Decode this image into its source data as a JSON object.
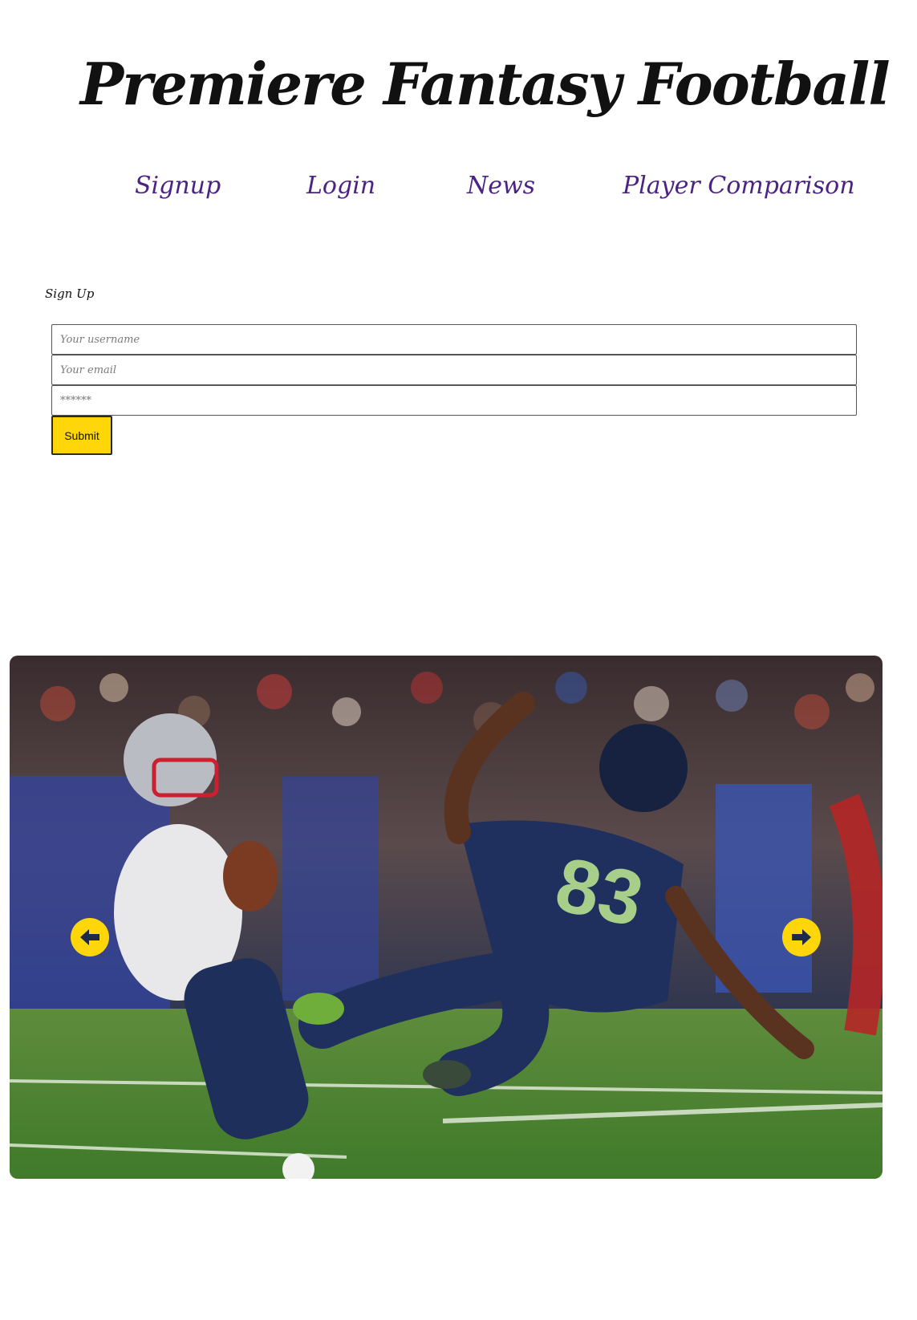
{
  "header": {
    "title": "Premiere Fantasy Football"
  },
  "nav": {
    "items": [
      {
        "label": "Signup"
      },
      {
        "label": "Login"
      },
      {
        "label": "News"
      },
      {
        "label": "Player Comparison"
      }
    ]
  },
  "signup": {
    "heading": "Sign Up",
    "username_placeholder": "Your username",
    "email_placeholder": "Your email",
    "password_placeholder": "******",
    "submit_label": "Submit"
  },
  "carousel": {
    "image_icon": "football-photo",
    "prev_icon": "arrow-left-icon",
    "next_icon": "arrow-right-icon"
  },
  "colors": {
    "nav_link": "#4b2382",
    "accent_yellow": "#ffd60a",
    "title": "#111111"
  }
}
